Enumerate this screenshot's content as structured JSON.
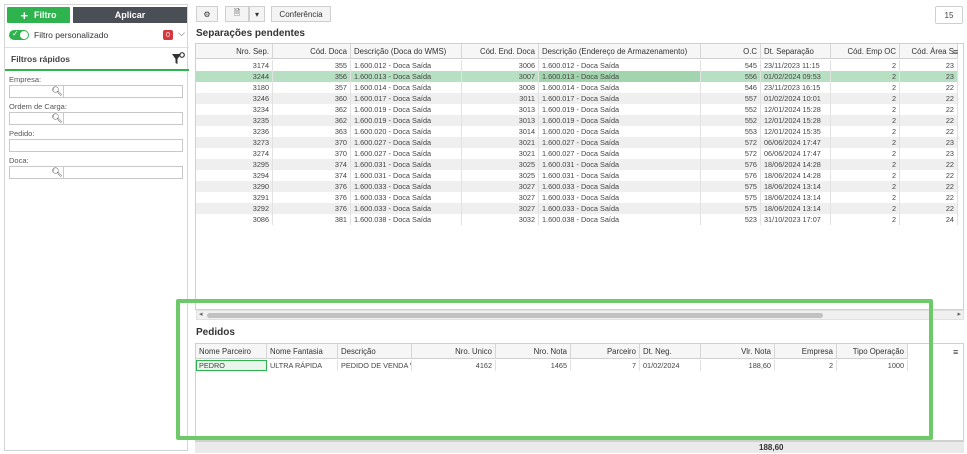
{
  "left": {
    "filtro_label": "Filtro",
    "aplicar_label": "Aplicar",
    "filtro_personalizado": "Filtro personalizado",
    "badge_count": "0",
    "quick_filters_title": "Filtros rápidos",
    "fields": [
      {
        "label": "Empresa:"
      },
      {
        "label": "Ordem de Carga:"
      },
      {
        "label": "Pedido:"
      },
      {
        "label": "Doca:"
      }
    ]
  },
  "toolbar": {
    "conferencia_label": "Conferência",
    "page_count": "15"
  },
  "separacoes": {
    "title": "Separações pendentes",
    "columns": [
      "Nro. Sep.",
      "Cód. Doca",
      "Descrição (Doca do WMS)",
      "Cód. End. Doca",
      "Descrição (Endereço de Armazenamento)",
      "O.C",
      "Dt. Separação",
      "Cód. Emp OC",
      "Cód. Área S"
    ],
    "rows": [
      [
        "3174",
        "355",
        "1.600.012 - Doca Saída",
        "3006",
        "1.600.012 - Doca Saída",
        "545",
        "23/11/2023 11:15",
        "2",
        "23"
      ],
      [
        "3244",
        "356",
        "1.600.013 - Doca Saída",
        "3007",
        "1.600.013 - Doca Saída",
        "556",
        "01/02/2024 09:53",
        "2",
        "23"
      ],
      [
        "3180",
        "357",
        "1.600.014 - Doca Saída",
        "3008",
        "1.600.014 - Doca Saída",
        "546",
        "23/11/2023 16:15",
        "2",
        "22"
      ],
      [
        "3246",
        "360",
        "1.600.017 - Doca Saída",
        "3011",
        "1.600.017 - Doca Saída",
        "557",
        "01/02/2024 10:01",
        "2",
        "22"
      ],
      [
        "3234",
        "362",
        "1.600.019 - Doca Saída",
        "3013",
        "1.600.019 - Doca Saída",
        "552",
        "12/01/2024 15:28",
        "2",
        "22"
      ],
      [
        "3235",
        "362",
        "1.600.019 - Doca Saída",
        "3013",
        "1.600.019 - Doca Saída",
        "552",
        "12/01/2024 15:28",
        "2",
        "22"
      ],
      [
        "3236",
        "363",
        "1.600.020 - Doca Saída",
        "3014",
        "1.600.020 - Doca Saída",
        "553",
        "12/01/2024 15:35",
        "2",
        "22"
      ],
      [
        "3273",
        "370",
        "1.600.027 - Doca Saída",
        "3021",
        "1.600.027 - Doca Saída",
        "572",
        "06/06/2024 17:47",
        "2",
        "23"
      ],
      [
        "3274",
        "370",
        "1.600.027 - Doca Saída",
        "3021",
        "1.600.027 - Doca Saída",
        "572",
        "06/06/2024 17:47",
        "2",
        "23"
      ],
      [
        "3295",
        "374",
        "1.600.031 - Doca Saída",
        "3025",
        "1.600.031 - Doca Saída",
        "576",
        "18/06/2024 14:28",
        "2",
        "22"
      ],
      [
        "3294",
        "374",
        "1.600.031 - Doca Saída",
        "3025",
        "1.600.031 - Doca Saída",
        "576",
        "18/06/2024 14:28",
        "2",
        "22"
      ],
      [
        "3290",
        "376",
        "1.600.033 - Doca Saída",
        "3027",
        "1.600.033 - Doca Saída",
        "575",
        "18/06/2024 13:14",
        "2",
        "22"
      ],
      [
        "3291",
        "376",
        "1.600.033 - Doca Saída",
        "3027",
        "1.600.033 - Doca Saída",
        "575",
        "18/06/2024 13:14",
        "2",
        "22"
      ],
      [
        "3292",
        "376",
        "1.600.033 - Doca Saída",
        "3027",
        "1.600.033 - Doca Saída",
        "575",
        "18/06/2024 13:14",
        "2",
        "22"
      ],
      [
        "3086",
        "381",
        "1.600.038 - Doca Saída",
        "3032",
        "1.600.038 - Doca Saída",
        "523",
        "31/10/2023 17:07",
        "2",
        "24"
      ]
    ]
  },
  "pedidos": {
    "title": "Pedidos",
    "columns": [
      "Nome Parceiro",
      "Nome Fantasia",
      "Descrição",
      "Nro. Unico",
      "Nro. Nota",
      "Parceiro",
      "Dt. Neg.",
      "Vlr. Nota",
      "Empresa",
      "Tipo Operação"
    ],
    "rows": [
      [
        "PEDRO",
        "ULTRA RÁPIDA",
        "PEDIDO DE VENDA V",
        "4162",
        "1465",
        "7",
        "01/02/2024",
        "188,60",
        "2",
        "1000"
      ]
    ],
    "total": "188,60"
  }
}
